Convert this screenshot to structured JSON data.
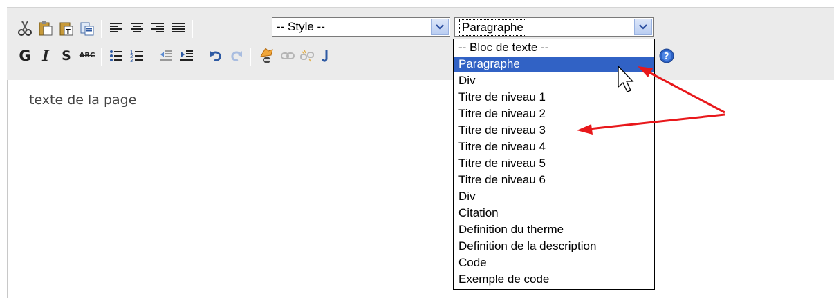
{
  "style_select": {
    "value": "-- Style --"
  },
  "format_select": {
    "value": "Paragraphe",
    "options": [
      "-- Bloc de texte --",
      "Paragraphe",
      "Div",
      "Titre de niveau 1",
      "Titre de niveau 2",
      "Titre de niveau 3",
      "Titre de niveau 4",
      "Titre de niveau 5",
      "Titre de niveau 6",
      "Div",
      "Citation",
      "Definition du therme",
      "Definition de la description",
      "Code",
      "Exemple de code"
    ],
    "selected_option": "Paragraphe"
  },
  "toolbar": {
    "bold_label": "G",
    "italic_label": "I",
    "strike_label": "S",
    "spell_label": "ABC"
  },
  "content": {
    "text": "texte de la page"
  },
  "colors": {
    "selection": "#3162c5",
    "arrow": "#e8181b",
    "toolbar_bg": "#ebebeb"
  }
}
